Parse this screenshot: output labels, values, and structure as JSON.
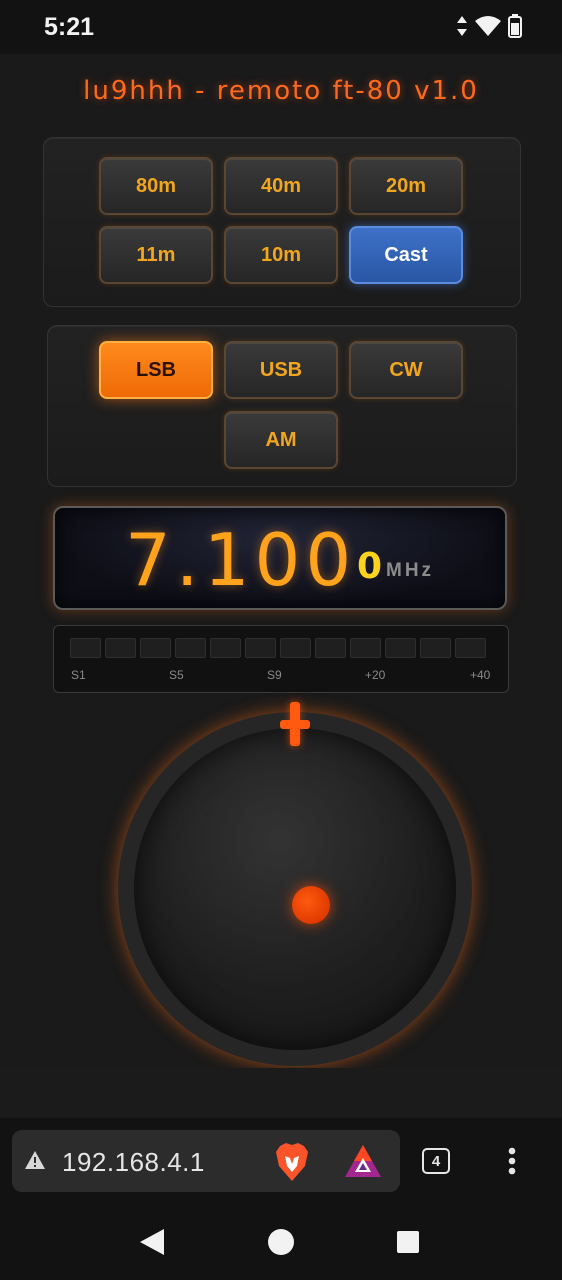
{
  "status_bar": {
    "time": "5:21"
  },
  "app": {
    "title": "lu9hhh - remoto ft-80 v1.0",
    "bands": [
      "80m",
      "40m",
      "20m",
      "11m",
      "10m",
      "Cast"
    ],
    "modes": [
      "LSB",
      "USB",
      "CW",
      "AM"
    ],
    "selected_mode": "LSB",
    "frequency": {
      "main": "7.100",
      "sub": "0",
      "unit": "MHz"
    },
    "s_meter": {
      "segments": 12,
      "lit_segments": 0,
      "labels": [
        "S1",
        "S5",
        "S9",
        "+20",
        "+40"
      ]
    }
  },
  "browser": {
    "url": "192.168.4.1",
    "tab_count": "4"
  },
  "colors": {
    "accent_orange": "#ff6a1a",
    "button_text": "#f2a61c",
    "cast_blue": "#2f62b8",
    "freq_digits": "#ffa21c"
  }
}
